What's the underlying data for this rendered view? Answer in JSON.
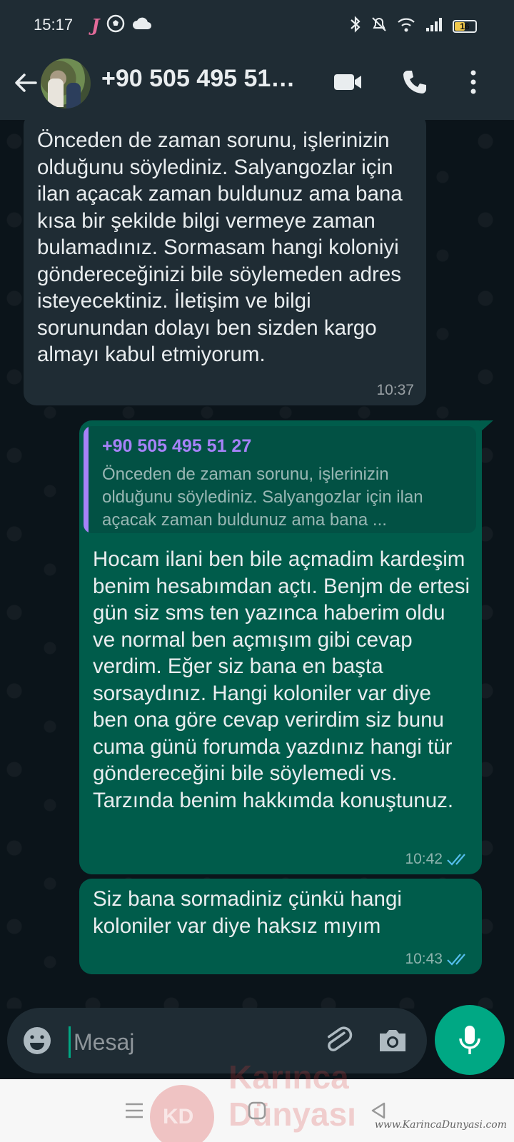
{
  "status_bar": {
    "time": "15:17",
    "battery_level": "16",
    "left_icons": [
      "notification-j-icon",
      "soccer-ball-icon",
      "cloud-icon"
    ],
    "right_icons": [
      "bluetooth-icon",
      "mute-icon",
      "wifi-icon",
      "signal-icon",
      "battery-icon"
    ]
  },
  "header": {
    "title": "+90 505 495 51…",
    "icons": [
      "back-arrow-icon",
      "avatar",
      "video-call-icon",
      "voice-call-icon",
      "more-options-icon"
    ]
  },
  "messages": [
    {
      "direction": "incoming",
      "text": "Önceden de zaman sorunu, işlerinizin olduğunu söylediniz. Salyangozlar için ilan açacak zaman buldunuz ama bana kısa bir şekilde bilgi vermeye zaman bulamadınız. Sormasam hangi koloniyi göndereceğinizi bile söylemeden adres isteyecektiniz. İletişim ve bilgi sorunundan dolayı ben sizden kargo almayı kabul etmiyorum.",
      "time": "10:37"
    },
    {
      "direction": "outgoing",
      "quote": {
        "author": "+90 505 495 51 27",
        "text": "Önceden de zaman sorunu, işlerinizin olduğunu söylediniz. Salyangozlar için ilan açacak zaman buldunuz ama bana ..."
      },
      "text": "Hocam ilani ben bile açmadim kardeşim benim hesabımdan açtı. Benjm de ertesi gün siz sms ten yazınca haberim oldu ve normal ben açmışım gibi cevap verdim. Eğer siz bana en başta sorsaydınız. Hangi koloniler var diye ben ona göre cevap verirdim siz bunu cuma günü forumda yazdınız hangi tür göndereceğini bile söylemedi vs. Tarzında benim hakkımda konuştunuz.",
      "time": "10:42",
      "status": "read"
    },
    {
      "direction": "outgoing",
      "text": "Siz bana sormadiniz çünkü hangi koloniler var diye haksız mıyım",
      "time": "10:43",
      "status": "read"
    }
  ],
  "composer": {
    "placeholder": "Mesaj",
    "value": ""
  },
  "watermark": {
    "logo_text": "KD",
    "title_line1": "Karınca",
    "title_line2": "Dünyası",
    "url": "www.KarincaDunyasi.com"
  },
  "colors": {
    "header_bg": "#1f2c34",
    "chat_bg": "#0b141a",
    "incoming_bubble": "#1f2c34",
    "outgoing_bubble": "#005c4b",
    "accent": "#00a884",
    "read_ticks": "#53bdeb",
    "quote_author": "#a682f8"
  }
}
